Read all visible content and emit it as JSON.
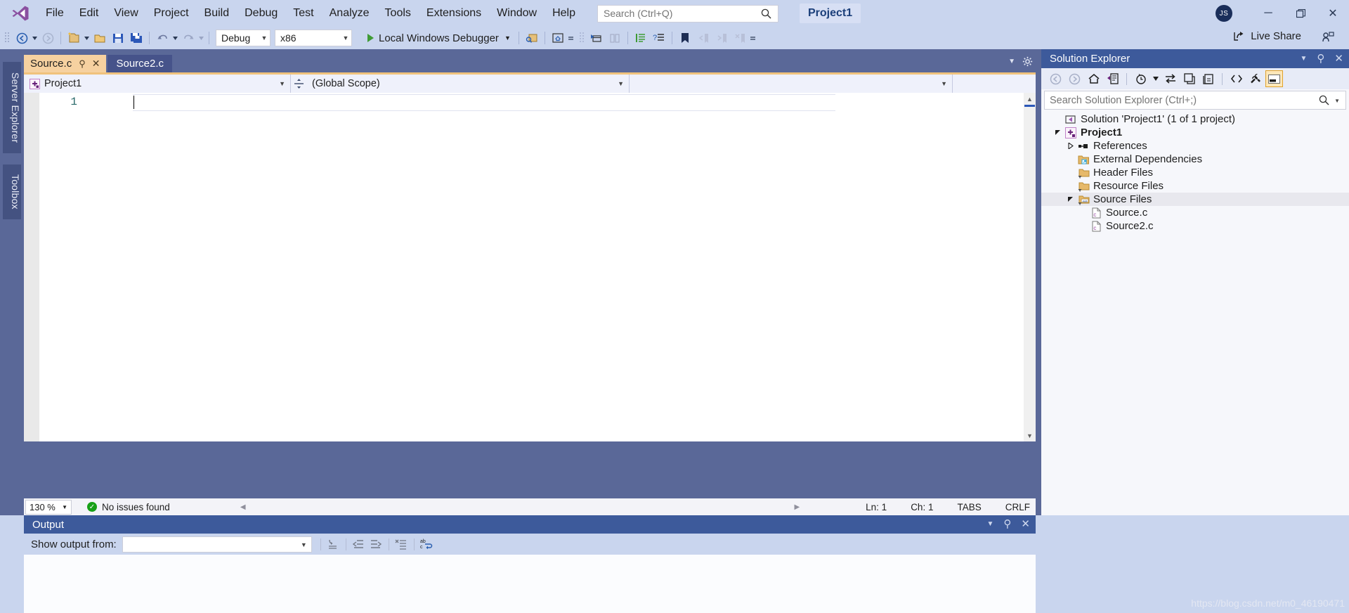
{
  "app": {
    "title": "Project1",
    "account_initials": "JS",
    "watermark": "https://blog.csdn.net/m0_46190471"
  },
  "menu": {
    "items": [
      {
        "label": "File"
      },
      {
        "label": "Edit"
      },
      {
        "label": "View"
      },
      {
        "label": "Project"
      },
      {
        "label": "Build"
      },
      {
        "label": "Debug"
      },
      {
        "label": "Test"
      },
      {
        "label": "Analyze"
      },
      {
        "label": "Tools"
      },
      {
        "label": "Extensions"
      },
      {
        "label": "Window"
      },
      {
        "label": "Help"
      }
    ],
    "search_placeholder": "Search (Ctrl+Q)"
  },
  "window_controls": {
    "minimize": "─",
    "restore": "❐",
    "close": "✕"
  },
  "toolbar": {
    "configuration": "Debug",
    "platform": "x86",
    "run_label": "Local Windows Debugger",
    "live_share": "Live Share"
  },
  "left_dock": {
    "tabs": [
      {
        "label": "Server Explorer"
      },
      {
        "label": "Toolbox"
      }
    ]
  },
  "editor": {
    "tabs": [
      {
        "label": "Source.c",
        "active": true
      },
      {
        "label": "Source2.c",
        "active": false
      }
    ],
    "nav": {
      "project": "Project1",
      "scope": "(Global Scope)",
      "member": ""
    },
    "line_numbers": [
      "1"
    ],
    "lines": [
      ""
    ],
    "status": {
      "zoom": "130 %",
      "issues": "No issues found",
      "line": "Ln: 1",
      "char": "Ch: 1",
      "tabs": "TABS",
      "eol": "CRLF"
    }
  },
  "solution_explorer": {
    "title": "Solution Explorer",
    "search_placeholder": "Search Solution Explorer (Ctrl+;)",
    "tree": [
      {
        "label": "Solution 'Project1' (1 of 1 project)",
        "indent": 0,
        "icon": "solution-icon",
        "expander": "none",
        "bold": false,
        "selected": false
      },
      {
        "label": "Project1",
        "indent": 1,
        "icon": "project-icon",
        "expander": "expanded",
        "bold": true,
        "selected": false
      },
      {
        "label": "References",
        "indent": 2,
        "icon": "references-icon",
        "expander": "collapsed",
        "bold": false,
        "selected": false
      },
      {
        "label": "External Dependencies",
        "indent": 2,
        "icon": "external-dependencies-icon",
        "expander": "none",
        "bold": false,
        "selected": false
      },
      {
        "label": "Header Files",
        "indent": 2,
        "icon": "filter-folder-icon",
        "expander": "none",
        "bold": false,
        "selected": false
      },
      {
        "label": "Resource Files",
        "indent": 2,
        "icon": "filter-folder-icon",
        "expander": "none",
        "bold": false,
        "selected": false
      },
      {
        "label": "Source Files",
        "indent": 2,
        "icon": "filter-folder-open-icon",
        "expander": "expanded",
        "bold": false,
        "selected": true
      },
      {
        "label": "Source.c",
        "indent": 3,
        "icon": "c-file-icon",
        "expander": "none",
        "bold": false,
        "selected": false
      },
      {
        "label": "Source2.c",
        "indent": 3,
        "icon": "c-file-icon",
        "expander": "none",
        "bold": false,
        "selected": false
      }
    ]
  },
  "output": {
    "title": "Output",
    "show_output_from_label": "Show output from:",
    "show_output_from_value": "",
    "body_text": ""
  },
  "colors": {
    "chrome": "#c9d5ee",
    "dock": "#5a6898",
    "panel_title": "#3d5a9b",
    "active_tab": "#f6d1a0",
    "accent_orange": "#f0c27c",
    "brand_purple": "#68217a",
    "ok_green": "#17a017"
  }
}
